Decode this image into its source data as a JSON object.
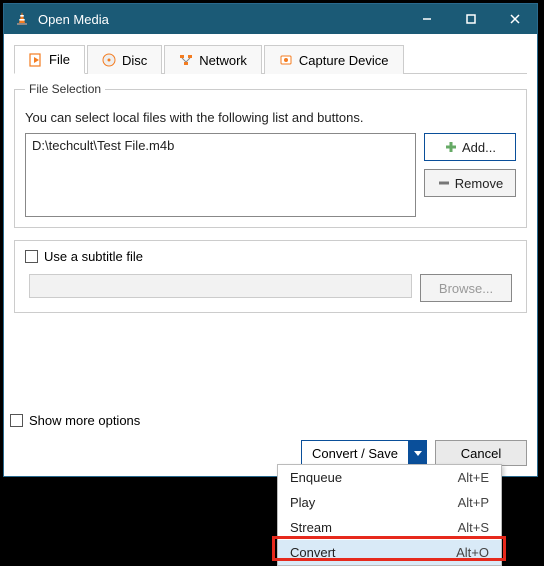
{
  "window": {
    "title": "Open Media"
  },
  "tabs": {
    "file": "File",
    "disc": "Disc",
    "network": "Network",
    "capture": "Capture Device"
  },
  "file_section": {
    "legend": "File Selection",
    "hint": "You can select local files with the following list and buttons.",
    "files": [
      "D:\\techcult\\Test File.m4b"
    ],
    "add": "Add...",
    "remove": "Remove"
  },
  "subtitle": {
    "checkbox_label": "Use a subtitle file",
    "browse": "Browse..."
  },
  "footer": {
    "show_more": "Show more options",
    "convert_save": "Convert / Save",
    "cancel": "Cancel"
  },
  "menu": {
    "items": [
      {
        "label": "Enqueue",
        "key": "Alt+E"
      },
      {
        "label": "Play",
        "key": "Alt+P"
      },
      {
        "label": "Stream",
        "key": "Alt+S"
      },
      {
        "label": "Convert",
        "key": "Alt+O"
      }
    ]
  }
}
